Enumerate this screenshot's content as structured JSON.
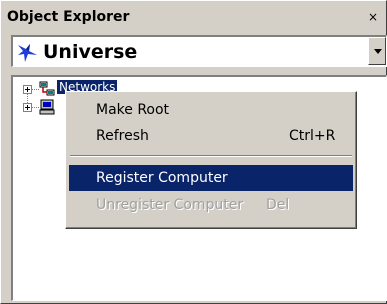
{
  "window": {
    "title": "Object Explorer",
    "close_glyph": "×"
  },
  "combo": {
    "icon": "labview-universe-icon",
    "value": "Universe"
  },
  "tree": {
    "nodes": [
      {
        "label": "Networks",
        "icon": "network-icon",
        "selected": true
      },
      {
        "label": "",
        "icon": "computer-icon",
        "selected": false
      }
    ]
  },
  "context_menu": {
    "items": [
      {
        "label": "Make Root",
        "shortcut": "",
        "state": "normal"
      },
      {
        "label": "Refresh",
        "shortcut": "Ctrl+R",
        "state": "normal"
      },
      {
        "label": "Register Computer",
        "shortcut": "",
        "state": "selected"
      },
      {
        "label": "Unregister Computer",
        "shortcut": "Del",
        "state": "disabled"
      }
    ]
  },
  "colors": {
    "face": "#d4d0c8",
    "highlight": "#0a246a",
    "disabled_text": "#a0a0a0"
  }
}
